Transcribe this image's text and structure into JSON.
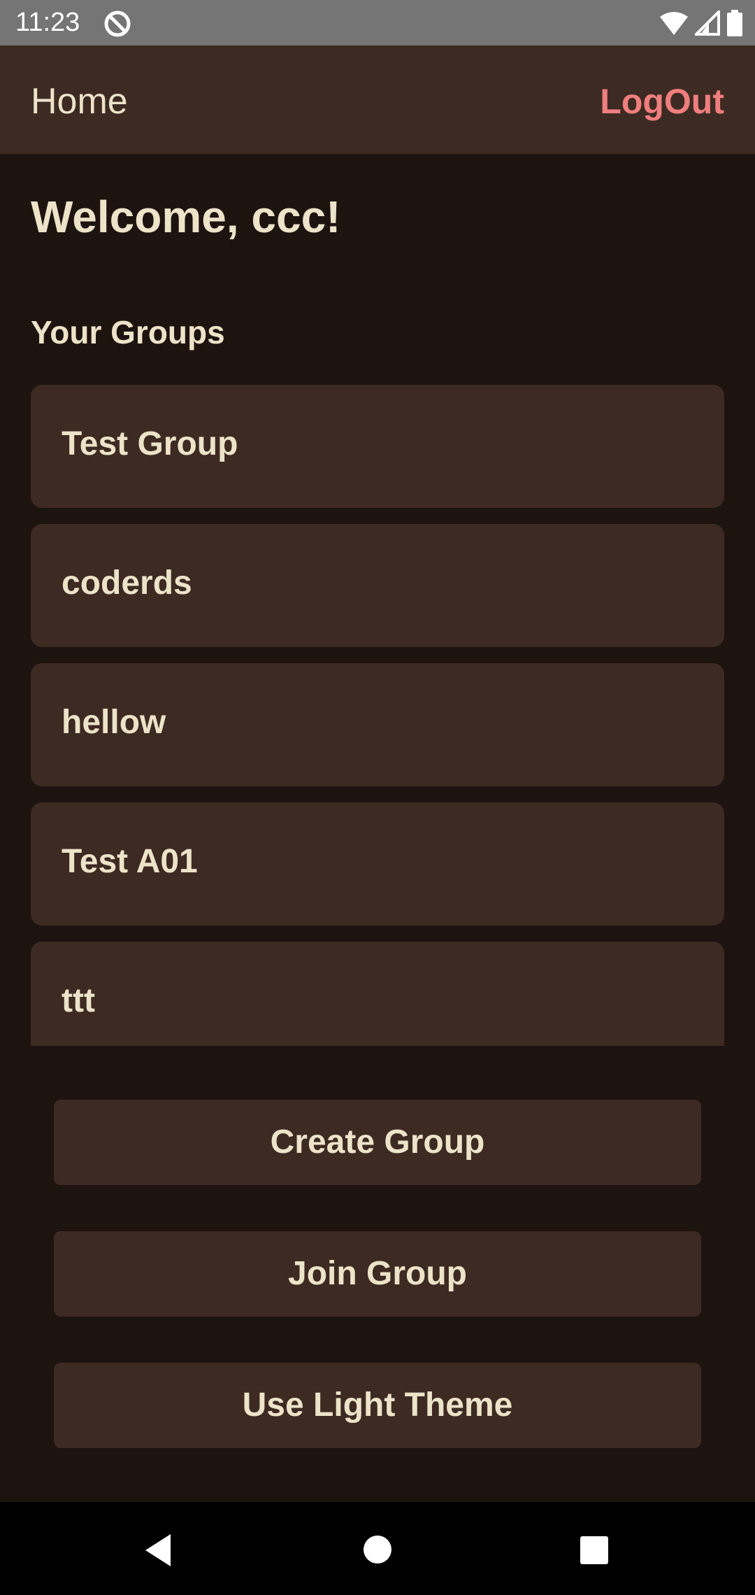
{
  "status_bar": {
    "time": "11:23",
    "icons": [
      "do-not-disturb-icon",
      "wifi-icon",
      "signal-icon",
      "battery-icon"
    ]
  },
  "app_bar": {
    "title": "Home",
    "logout_label": "LogOut"
  },
  "main": {
    "welcome": "Welcome, ccc!",
    "groups_heading": "Your Groups",
    "groups": [
      {
        "name": "Test Group"
      },
      {
        "name": "coderds"
      },
      {
        "name": "hellow"
      },
      {
        "name": "Test A01"
      },
      {
        "name": "ttt"
      }
    ]
  },
  "actions": {
    "create_group": "Create Group",
    "join_group": "Join Group",
    "theme_toggle": "Use Light Theme"
  },
  "navigation": {
    "icons": [
      "back-icon",
      "home-icon",
      "recents-icon"
    ]
  },
  "colors": {
    "background": "#1d1410",
    "surface": "#3d2a22",
    "text": "#ede3c9",
    "accent": "#ef7e7e"
  }
}
